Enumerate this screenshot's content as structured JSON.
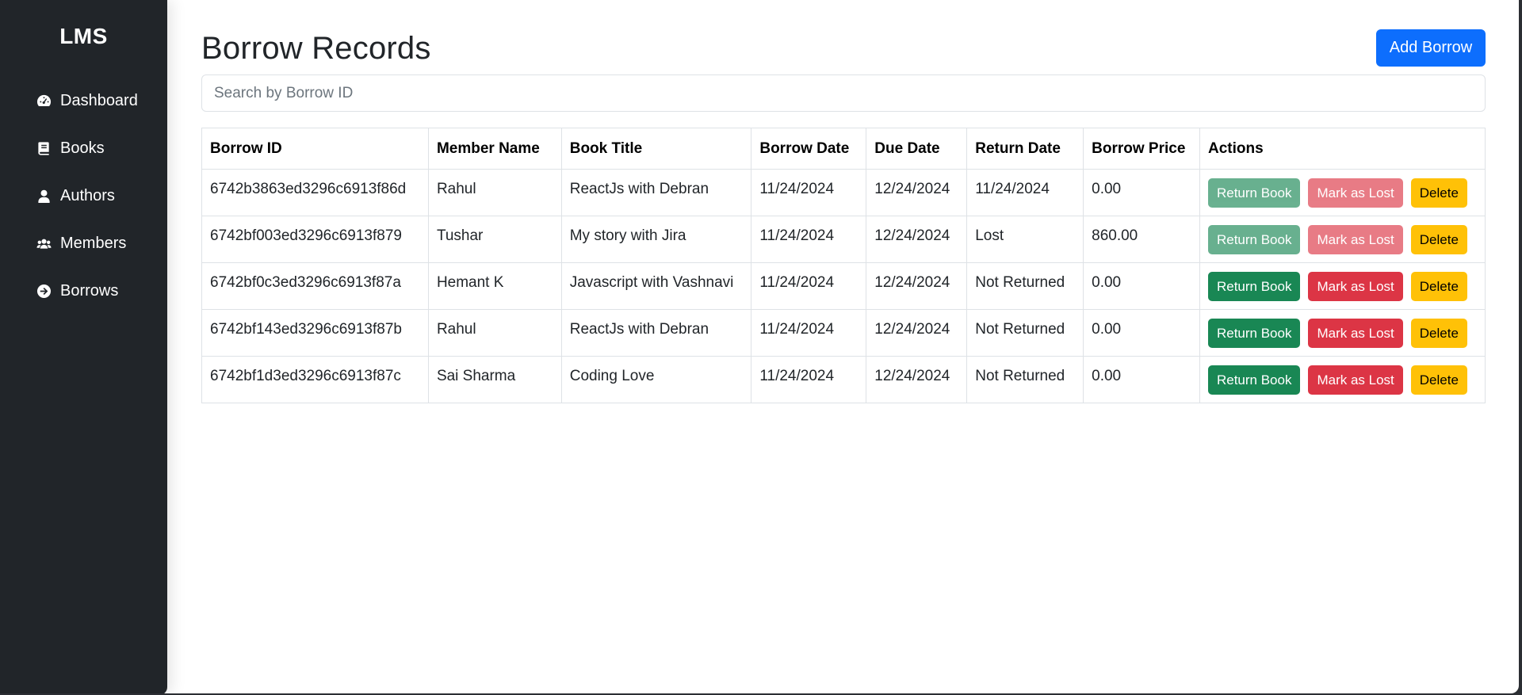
{
  "sidebar": {
    "brand": "LMS",
    "items": [
      {
        "label": "Dashboard",
        "icon": "dashboard-icon"
      },
      {
        "label": "Books",
        "icon": "book-icon"
      },
      {
        "label": "Authors",
        "icon": "user-icon"
      },
      {
        "label": "Members",
        "icon": "users-icon"
      },
      {
        "label": "Borrows",
        "icon": "arrow-circle-right-icon"
      }
    ]
  },
  "main": {
    "title": "Borrow Records",
    "add_button": "Add Borrow",
    "search": {
      "placeholder": "Search by Borrow ID",
      "value": ""
    }
  },
  "table": {
    "headers": [
      "Borrow ID",
      "Member Name",
      "Book Title",
      "Borrow Date",
      "Due Date",
      "Return Date",
      "Borrow Price",
      "Actions"
    ],
    "rows": [
      {
        "id": "6742b3863ed3296c6913f86d",
        "member": "Rahul",
        "book": "ReactJs with Debran",
        "borrow_date": "11/24/2024",
        "due_date": "12/24/2024",
        "return_date": "11/24/2024",
        "price": "0.00",
        "actions_enabled": false
      },
      {
        "id": "6742bf003ed3296c6913f879",
        "member": "Tushar",
        "book": "My story with Jira",
        "borrow_date": "11/24/2024",
        "due_date": "12/24/2024",
        "return_date": "Lost",
        "price": "860.00",
        "actions_enabled": false
      },
      {
        "id": "6742bf0c3ed3296c6913f87a",
        "member": "Hemant K",
        "book": "Javascript with Vashnavi",
        "borrow_date": "11/24/2024",
        "due_date": "12/24/2024",
        "return_date": "Not Returned",
        "price": "0.00",
        "actions_enabled": true
      },
      {
        "id": "6742bf143ed3296c6913f87b",
        "member": "Rahul",
        "book": "ReactJs with Debran",
        "borrow_date": "11/24/2024",
        "due_date": "12/24/2024",
        "return_date": "Not Returned",
        "price": "0.00",
        "actions_enabled": true
      },
      {
        "id": "6742bf1d3ed3296c6913f87c",
        "member": "Sai Sharma",
        "book": "Coding Love",
        "borrow_date": "11/24/2024",
        "due_date": "12/24/2024",
        "return_date": "Not Returned",
        "price": "0.00",
        "actions_enabled": true
      }
    ],
    "action_labels": {
      "return": "Return Book",
      "lost": "Mark as Lost",
      "delete": "Delete"
    }
  },
  "colors": {
    "sidebar_bg": "#212529",
    "primary": "#0d6efd",
    "success": "#198754",
    "danger": "#dc3545",
    "warning": "#ffc107"
  }
}
